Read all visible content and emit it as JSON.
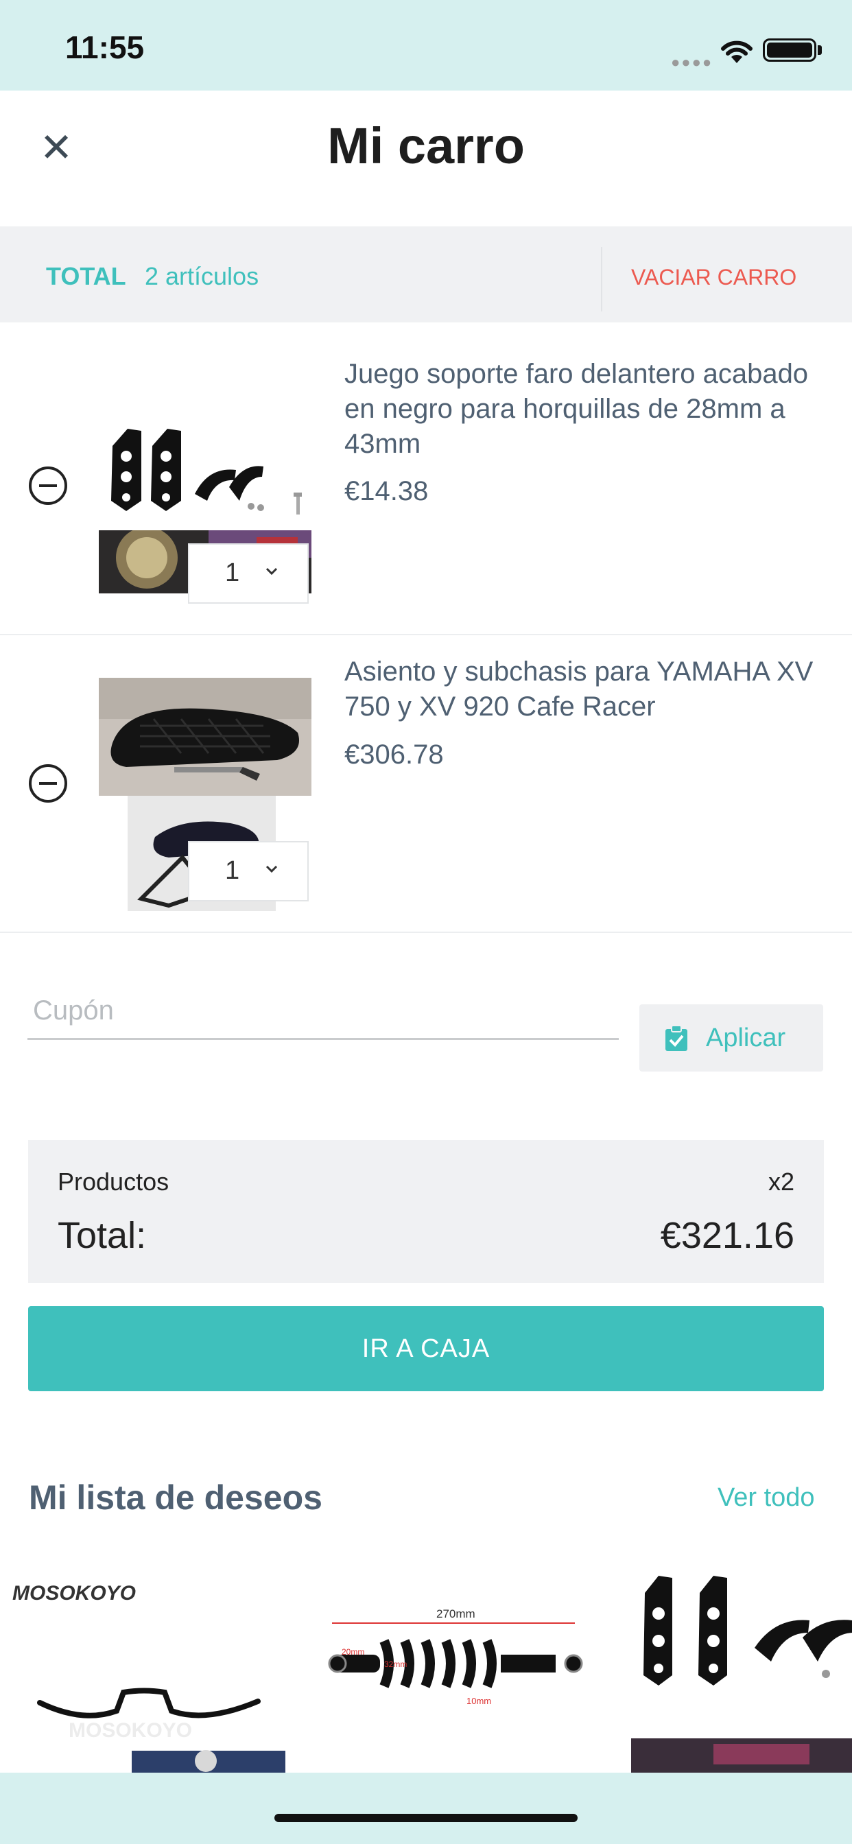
{
  "status_bar": {
    "time": "11:55"
  },
  "header": {
    "title": "Mi carro",
    "close_icon": "close-icon"
  },
  "total_bar": {
    "label": "TOTAL",
    "count": "2 artículos",
    "empty_button": "VACIAR CARRO"
  },
  "cart_items": [
    {
      "name": "Juego soporte faro delantero acabado en negro para horquillas de 28mm a 43mm",
      "price": "€14.38",
      "quantity": "1"
    },
    {
      "name": "Asiento y subchasis para YAMAHA XV 750 y XV 920 Cafe Racer",
      "price": "€306.78",
      "quantity": "1"
    }
  ],
  "coupon": {
    "placeholder": "Cupón",
    "value": "",
    "apply_label": "Aplicar"
  },
  "summary": {
    "products_label": "Productos",
    "products_count": "x2",
    "total_label": "Total:",
    "total_value": "€321.16"
  },
  "checkout": {
    "label": "IR A CAJA"
  },
  "wishlist": {
    "title": "Mi lista de deseos",
    "view_all": "Ver todo",
    "items": [
      {
        "brand_text": "MOSOKOYO",
        "watermark": "MOSOKOYO"
      },
      {
        "dimension_labels": [
          "270mm",
          "20mm",
          "32mm",
          "10mm"
        ]
      },
      {
        "image": "headlight-bracket"
      }
    ]
  },
  "colors": {
    "accent": "#3fc0bc",
    "danger": "#ec5a50",
    "text": "#4f6072",
    "statusbar_bg": "#d6f0ef"
  }
}
